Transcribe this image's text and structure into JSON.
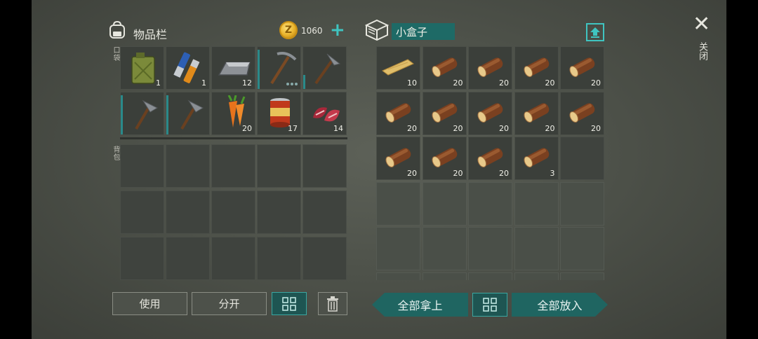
{
  "inventory": {
    "title": "物品栏",
    "coins": "1060",
    "pocket_label": "口袋",
    "backpack_label": "背包",
    "pocket_items": [
      {
        "icon": "jerrycan-icon",
        "qty": "1"
      },
      {
        "icon": "batteries-icon",
        "qty": "1"
      },
      {
        "icon": "iron-ingot-icon",
        "qty": "12"
      },
      {
        "icon": "pickaxe-icon",
        "qty": ""
      },
      {
        "icon": "pickaxe-icon",
        "qty": ""
      },
      {
        "icon": "stone-hatchet-icon",
        "qty": ""
      },
      {
        "icon": "stone-hatchet-icon",
        "qty": ""
      },
      {
        "icon": "carrot-icon",
        "qty": "20"
      },
      {
        "icon": "canned-food-icon",
        "qty": "17"
      },
      {
        "icon": "raw-meat-icon",
        "qty": "14"
      }
    ],
    "use_label": "使用",
    "split_label": "分开"
  },
  "container": {
    "name": "小盒子",
    "items": [
      {
        "icon": "plank-icon",
        "qty": "10"
      },
      {
        "icon": "log-icon",
        "qty": "20"
      },
      {
        "icon": "log-icon",
        "qty": "20"
      },
      {
        "icon": "log-icon",
        "qty": "20"
      },
      {
        "icon": "log-icon",
        "qty": "20"
      },
      {
        "icon": "log-icon",
        "qty": "20"
      },
      {
        "icon": "log-icon",
        "qty": "20"
      },
      {
        "icon": "log-icon",
        "qty": "20"
      },
      {
        "icon": "log-icon",
        "qty": "20"
      },
      {
        "icon": "log-icon",
        "qty": "20"
      },
      {
        "icon": "log-icon",
        "qty": "20"
      },
      {
        "icon": "log-icon",
        "qty": "20"
      },
      {
        "icon": "log-icon",
        "qty": "20"
      },
      {
        "icon": "log-icon",
        "qty": "3"
      }
    ],
    "take_all_label": "全部拿上",
    "put_all_label": "全部放入"
  },
  "close_label": "关闭",
  "colors": {
    "accent": "#2a9a94",
    "coin": "#e9b22a"
  }
}
